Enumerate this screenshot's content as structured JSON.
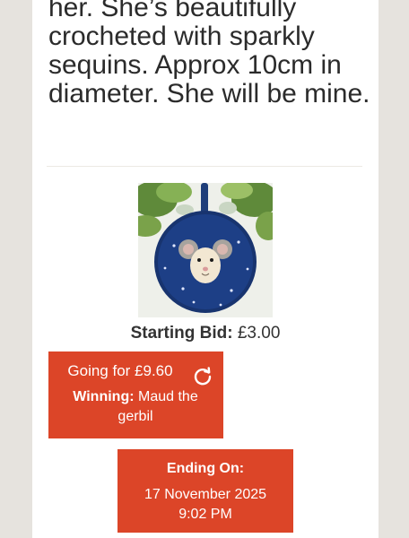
{
  "listing": {
    "description_tail": "her. She’s beautifully crocheted with sparkly sequins. Approx 10cm in diameter. She will be mine.",
    "image_icon": "crochet-mouse-ornament-photo"
  },
  "bid": {
    "starting_label": "Starting Bid:",
    "starting_value": "£3.00",
    "going_for": "Going for £9.60",
    "winning_label": "Winning:",
    "winning_name": "Maud the gerbil",
    "refresh_icon": "refresh-icon"
  },
  "ending": {
    "label": "Ending On:",
    "date": "17 November 2025",
    "time": "9:02 PM"
  },
  "colors": {
    "accent": "#dc4528",
    "page_bg": "#e6e3de",
    "text": "#2b2b2b"
  }
}
